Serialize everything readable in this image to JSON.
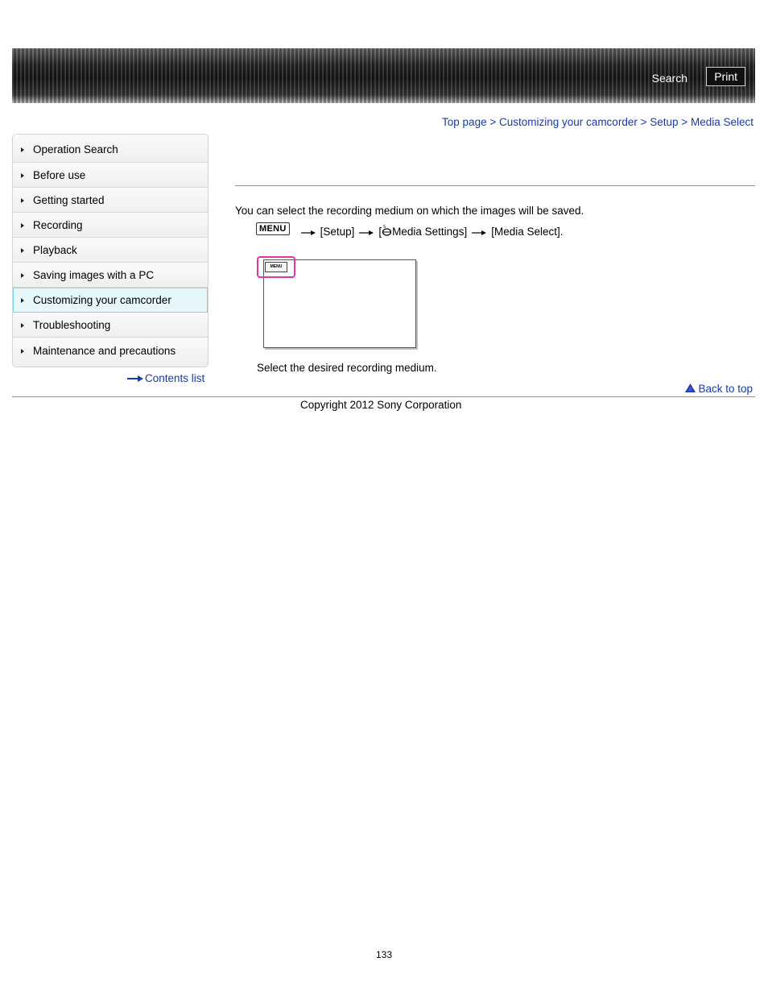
{
  "header": {
    "search_label": "Search",
    "print_label": "Print"
  },
  "breadcrumb": {
    "items": [
      "Top page",
      "Customizing your camcorder",
      "Setup",
      "Media Select"
    ],
    "separator": ">"
  },
  "sidebar": {
    "items": [
      {
        "label": "Operation Search"
      },
      {
        "label": "Before use"
      },
      {
        "label": "Getting started"
      },
      {
        "label": "Recording"
      },
      {
        "label": "Playback"
      },
      {
        "label": "Saving images with a PC"
      },
      {
        "label": "Customizing your camcorder"
      },
      {
        "label": "Troubleshooting"
      },
      {
        "label": "Maintenance and precautions"
      }
    ],
    "active_index": 6,
    "contents_link": "Contents list"
  },
  "main": {
    "intro": "You can select the recording medium on which the images will be saved.",
    "menu_key": "MENU",
    "steps": [
      "[Setup]",
      "[",
      "Media Settings]",
      "[Media Select]."
    ],
    "mini_menu_label": "MENU",
    "step_text": "Select the desired recording medium.",
    "back_to_top": "Back to top"
  },
  "footer": {
    "copyright": "Copyright 2012 Sony Corporation",
    "page_number": "133"
  },
  "colors": {
    "link": "#1a3aa6",
    "highlight": "#e0379a",
    "active_item_bg": "#e6f7fc"
  }
}
